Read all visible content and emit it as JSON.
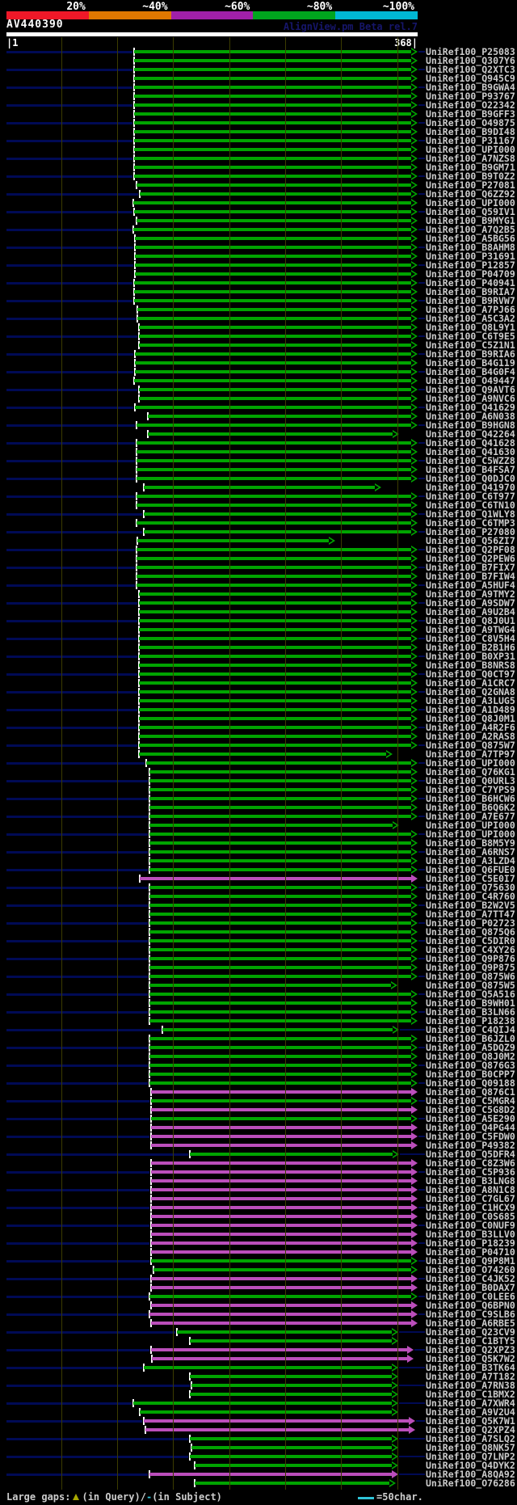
{
  "header": {
    "query_name": "AV440390",
    "watermark": "AlignView.pm Beta rel.7",
    "scale_labels": [
      "20%",
      "~40%",
      "~60%",
      "~80%",
      "~100%"
    ],
    "ruler_left": "|1",
    "ruler_right": "368|"
  },
  "legend": {
    "large_gaps_label": "Large gaps: ",
    "query_gap_note": "(in Query)/",
    "subject_dash": "-",
    "subject_gap_note": " (in Subject)",
    "scale_note": "=50char."
  },
  "colors": {
    "green": "#00a400",
    "magenta": "#bb4ebb",
    "navy": "#000a55",
    "grid": "#3c3c00",
    "label": "#cccccc",
    "watermark": "#16166a",
    "legend_cyan": "#2fc4d8",
    "gap_triangle": "#a8a800",
    "scale_segments": [
      "#ef1828",
      "#e07800",
      "#a020a8",
      "#00a51e",
      "#00b8d4"
    ]
  },
  "chart_data": {
    "type": "bar",
    "title": "AV440390",
    "x_axis": {
      "start": 1,
      "end": 368,
      "tick_interval": 50,
      "scale_note": "=50char."
    },
    "row_format": [
      "label",
      "color g=green m=magenta",
      "align_start_residue",
      "align_end_residue"
    ],
    "rows": [
      [
        "UniRef100_P25083",
        "g",
        115,
        368
      ],
      [
        "UniRef100_Q307Y6",
        "g",
        115,
        368
      ],
      [
        "UniRef100_Q2XTC3",
        "g",
        115,
        368
      ],
      [
        "UniRef100_Q945C9",
        "g",
        115,
        368
      ],
      [
        "UniRef100_B9GWA4",
        "g",
        115,
        368
      ],
      [
        "UniRef100_P93767",
        "g",
        115,
        368
      ],
      [
        "UniRef100_O22342",
        "g",
        115,
        368
      ],
      [
        "UniRef100_B9GFF3",
        "g",
        115,
        368
      ],
      [
        "UniRef100_O49875",
        "g",
        115,
        368
      ],
      [
        "UniRef100_B9DI48",
        "g",
        115,
        368
      ],
      [
        "UniRef100_P31167",
        "g",
        115,
        368
      ],
      [
        "UniRef100_UPI000..",
        "g",
        115,
        368
      ],
      [
        "UniRef100_A7NZS8",
        "g",
        115,
        368
      ],
      [
        "UniRef100_B9GM71",
        "g",
        115,
        368
      ],
      [
        "UniRef100_B9T0Z2",
        "g",
        115,
        368
      ],
      [
        "UniRef100_P27081",
        "g",
        117,
        368
      ],
      [
        "UniRef100_Q6ZZ92",
        "g",
        120,
        368
      ],
      [
        "UniRef100_UPI000..",
        "g",
        114,
        368
      ],
      [
        "UniRef100_Q59IV1",
        "g",
        115,
        368
      ],
      [
        "UniRef100_B9MYG1",
        "g",
        117,
        368
      ],
      [
        "UniRef100_A7Q2B5",
        "g",
        114,
        368
      ],
      [
        "UniRef100_A5BG56",
        "g",
        116,
        368
      ],
      [
        "UniRef100_B8AHM8",
        "g",
        116,
        368
      ],
      [
        "UniRef100_P31691",
        "g",
        116,
        368
      ],
      [
        "UniRef100_P12857",
        "g",
        116,
        368
      ],
      [
        "UniRef100_P04709",
        "g",
        116,
        368
      ],
      [
        "UniRef100_P40941",
        "g",
        115,
        368
      ],
      [
        "UniRef100_B9RIA7",
        "g",
        115,
        368
      ],
      [
        "UniRef100_B9RVW7",
        "g",
        115,
        368
      ],
      [
        "UniRef100_A7PJ66",
        "g",
        118,
        368
      ],
      [
        "UniRef100_A5C3A2",
        "g",
        118,
        368
      ],
      [
        "UniRef100_Q8L9Y1",
        "g",
        119,
        368
      ],
      [
        "UniRef100_C6T9E5",
        "g",
        119,
        368
      ],
      [
        "UniRef100_C5Z1N1",
        "g",
        119,
        368
      ],
      [
        "UniRef100_B9RIA6",
        "g",
        116,
        368
      ],
      [
        "UniRef100_B4G119",
        "g",
        116,
        368
      ],
      [
        "UniRef100_B4G0F4",
        "g",
        116,
        368
      ],
      [
        "UniRef100_O49447",
        "g",
        115,
        368
      ],
      [
        "UniRef100_Q9AVT6",
        "g",
        119,
        368
      ],
      [
        "UniRef100_A9NVC6",
        "g",
        119,
        368
      ],
      [
        "UniRef100_Q41629",
        "g",
        116,
        368
      ],
      [
        "UniRef100_A6N038",
        "g",
        127,
        368
      ],
      [
        "UniRef100_B9HGN8",
        "g",
        117,
        368
      ],
      [
        "UniRef100_Q42264",
        "g",
        127,
        352
      ],
      [
        "UniRef100_Q41628",
        "g",
        117,
        368
      ],
      [
        "UniRef100_Q41630",
        "g",
        117,
        368
      ],
      [
        "UniRef100_C5WZZ8",
        "g",
        117,
        368
      ],
      [
        "UniRef100_B4FSA7",
        "g",
        117,
        368
      ],
      [
        "UniRef100_Q0DJC0",
        "g",
        117,
        368
      ],
      [
        "UniRef100_Q41970",
        "g",
        124,
        336
      ],
      [
        "UniRef100_C6T977",
        "g",
        117,
        368
      ],
      [
        "UniRef100_C6TN10",
        "g",
        117,
        368
      ],
      [
        "UniRef100_Q1WLY8",
        "g",
        124,
        368
      ],
      [
        "UniRef100_C6TMP3",
        "g",
        117,
        368
      ],
      [
        "UniRef100_P27080",
        "g",
        124,
        368
      ],
      [
        "UniRef100_Q56ZI7",
        "g",
        118,
        295
      ],
      [
        "UniRef100_Q2PF08",
        "g",
        117,
        368
      ],
      [
        "UniRef100_Q2PEW6",
        "g",
        117,
        368
      ],
      [
        "UniRef100_B7FIX7",
        "g",
        117,
        368
      ],
      [
        "UniRef100_B7FIW4",
        "g",
        117,
        368
      ],
      [
        "UniRef100_A5HUF4",
        "g",
        117,
        368
      ],
      [
        "UniRef100_A9TMY2",
        "g",
        119,
        368
      ],
      [
        "UniRef100_A9SDW7",
        "g",
        119,
        368
      ],
      [
        "UniRef100_A9U2B4",
        "g",
        119,
        368
      ],
      [
        "UniRef100_Q8J0U1",
        "g",
        119,
        368
      ],
      [
        "UniRef100_A9TWG4",
        "g",
        119,
        368
      ],
      [
        "UniRef100_C8V5H4",
        "g",
        119,
        368
      ],
      [
        "UniRef100_B2B1H6",
        "g",
        119,
        368
      ],
      [
        "UniRef100_B0XP31",
        "g",
        119,
        368
      ],
      [
        "UniRef100_B8NRS8",
        "g",
        119,
        368
      ],
      [
        "UniRef100_Q0CT97",
        "g",
        119,
        368
      ],
      [
        "UniRef100_A1CRC7",
        "g",
        119,
        368
      ],
      [
        "UniRef100_Q2GNA8",
        "g",
        119,
        368
      ],
      [
        "UniRef100_A3LUG5",
        "g",
        119,
        368
      ],
      [
        "UniRef100_A1D489",
        "g",
        119,
        368
      ],
      [
        "UniRef100_Q8J0M1",
        "g",
        119,
        368
      ],
      [
        "UniRef100_A4R2F6",
        "g",
        119,
        368
      ],
      [
        "UniRef100_A2RAS8",
        "g",
        119,
        368
      ],
      [
        "UniRef100_Q875W7",
        "g",
        119,
        368
      ],
      [
        "UniRef100_A7TP97",
        "g",
        119,
        346
      ],
      [
        "UniRef100_UPI000..",
        "g",
        126,
        368
      ],
      [
        "UniRef100_Q76KG1",
        "g",
        129,
        368
      ],
      [
        "UniRef100_Q0URL3",
        "g",
        129,
        368
      ],
      [
        "UniRef100_C7YPS9",
        "g",
        129,
        368
      ],
      [
        "UniRef100_B6HCW6",
        "g",
        129,
        368
      ],
      [
        "UniRef100_B6Q6K2",
        "g",
        129,
        368
      ],
      [
        "UniRef100_A7E677",
        "g",
        129,
        368
      ],
      [
        "UniRef100_UPI000..",
        "g",
        129,
        352
      ],
      [
        "UniRef100_UPI000..",
        "g",
        129,
        368
      ],
      [
        "UniRef100_B8M5Y9",
        "g",
        129,
        368
      ],
      [
        "UniRef100_A6RNS7",
        "g",
        129,
        368
      ],
      [
        "UniRef100_A3LZD4",
        "g",
        129,
        368
      ],
      [
        "UniRef100_Q6FUE0",
        "g",
        129,
        368
      ],
      [
        "UniRef100_C5E0I7",
        "m",
        120,
        368
      ],
      [
        "UniRef100_Q75630",
        "g",
        129,
        368
      ],
      [
        "UniRef100_C4R760",
        "g",
        129,
        368
      ],
      [
        "UniRef100_B2W2V5",
        "g",
        129,
        368
      ],
      [
        "UniRef100_A7TT47",
        "g",
        129,
        368
      ],
      [
        "UniRef100_P02723",
        "g",
        129,
        368
      ],
      [
        "UniRef100_Q875Q6",
        "g",
        129,
        368
      ],
      [
        "UniRef100_C5DIR0",
        "g",
        129,
        368
      ],
      [
        "UniRef100_C4XY26",
        "g",
        129,
        368
      ],
      [
        "UniRef100_Q9P876",
        "g",
        129,
        368
      ],
      [
        "UniRef100_Q9P875",
        "g",
        129,
        368
      ],
      [
        "UniRef100_Q875W6",
        "g",
        129,
        368
      ],
      [
        "UniRef100_Q875W5",
        "g",
        129,
        350
      ],
      [
        "UniRef100_Q5A516",
        "g",
        129,
        368
      ],
      [
        "UniRef100_B9WH01",
        "g",
        129,
        368
      ],
      [
        "UniRef100_B3LN66",
        "g",
        129,
        368
      ],
      [
        "UniRef100_P18238",
        "g",
        129,
        368
      ],
      [
        "UniRef100_C4QIJ4",
        "g",
        140,
        352
      ],
      [
        "UniRef100_B6JZL0",
        "g",
        129,
        368
      ],
      [
        "UniRef100_A5DQZ9",
        "g",
        129,
        368
      ],
      [
        "UniRef100_Q8J0M2",
        "g",
        129,
        368
      ],
      [
        "UniRef100_Q876G3",
        "g",
        129,
        368
      ],
      [
        "UniRef100_B0CPP7",
        "g",
        129,
        368
      ],
      [
        "UniRef100_Q09188",
        "g",
        129,
        368
      ],
      [
        "UniRef100_Q876C1",
        "m",
        130,
        368
      ],
      [
        "UniRef100_C5MGR4",
        "g",
        130,
        368
      ],
      [
        "UniRef100_C5G8D2",
        "m",
        130,
        368
      ],
      [
        "UniRef100_A5E290",
        "g",
        130,
        368
      ],
      [
        "UniRef100_Q4PG44",
        "m",
        130,
        368
      ],
      [
        "UniRef100_C5FDW0",
        "m",
        130,
        368
      ],
      [
        "UniRef100_P49382",
        "m",
        130,
        368
      ],
      [
        "UniRef100_Q5DFR4",
        "g",
        165,
        352
      ],
      [
        "UniRef100_C8Z3W6",
        "m",
        130,
        368
      ],
      [
        "UniRef100_C5P936",
        "m",
        130,
        368
      ],
      [
        "UniRef100_B3LNG8",
        "m",
        130,
        368
      ],
      [
        "UniRef100_A8N1C8",
        "m",
        130,
        368
      ],
      [
        "UniRef100_C7GL67",
        "m",
        130,
        368
      ],
      [
        "UniRef100_C1HCX9",
        "m",
        130,
        368
      ],
      [
        "UniRef100_C0S685",
        "m",
        130,
        368
      ],
      [
        "UniRef100_C0NUF9",
        "m",
        130,
        368
      ],
      [
        "UniRef100_B3LLV0",
        "m",
        130,
        368
      ],
      [
        "UniRef100_P18239",
        "m",
        130,
        368
      ],
      [
        "UniRef100_P04710",
        "m",
        130,
        368
      ],
      [
        "UniRef100_Q9P8M1",
        "g",
        130,
        368
      ],
      [
        "UniRef100_O74260",
        "g",
        132,
        368
      ],
      [
        "UniRef100_C4JK52",
        "m",
        130,
        368
      ],
      [
        "UniRef100_B0DAX7",
        "m",
        130,
        368
      ],
      [
        "UniRef100_C0LEE6",
        "g",
        129,
        368
      ],
      [
        "UniRef100_Q6BPN0",
        "m",
        130,
        368
      ],
      [
        "UniRef100_C9SLB6",
        "m",
        129,
        368
      ],
      [
        "UniRef100_A6RBE5",
        "m",
        130,
        368
      ],
      [
        "UniRef100_Q23CV9",
        "g",
        153,
        351
      ],
      [
        "UniRef100_C1BTY5",
        "g",
        165,
        351
      ],
      [
        "UniRef100_Q2XPZ3",
        "m",
        130,
        365
      ],
      [
        "UniRef100_Q5K7W2",
        "m",
        131,
        365
      ],
      [
        "UniRef100_B3TK64",
        "g",
        124,
        351
      ],
      [
        "UniRef100_A7T182",
        "g",
        165,
        351
      ],
      [
        "UniRef100_A7RN38",
        "g",
        166,
        351
      ],
      [
        "UniRef100_C1BMX2",
        "g",
        165,
        351
      ],
      [
        "UniRef100_A7XWR4",
        "g",
        114,
        351
      ],
      [
        "UniRef100_A9V2U4",
        "g",
        120,
        351
      ],
      [
        "UniRef100_Q5K7W1",
        "m",
        124,
        366
      ],
      [
        "UniRef100_Q2XPZ4",
        "m",
        125,
        366
      ],
      [
        "UniRef100_A7SLQ2",
        "g",
        165,
        351
      ],
      [
        "UniRef100_Q8NK57",
        "g",
        166,
        351
      ],
      [
        "UniRef100_Q7LNP2",
        "g",
        165,
        351
      ],
      [
        "UniRef100_Q4DYK2",
        "g",
        169,
        351
      ],
      [
        "UniRef100_A8QA92",
        "m",
        129,
        351
      ],
      [
        "UniRef100_O76286",
        "g",
        169,
        349
      ]
    ]
  }
}
